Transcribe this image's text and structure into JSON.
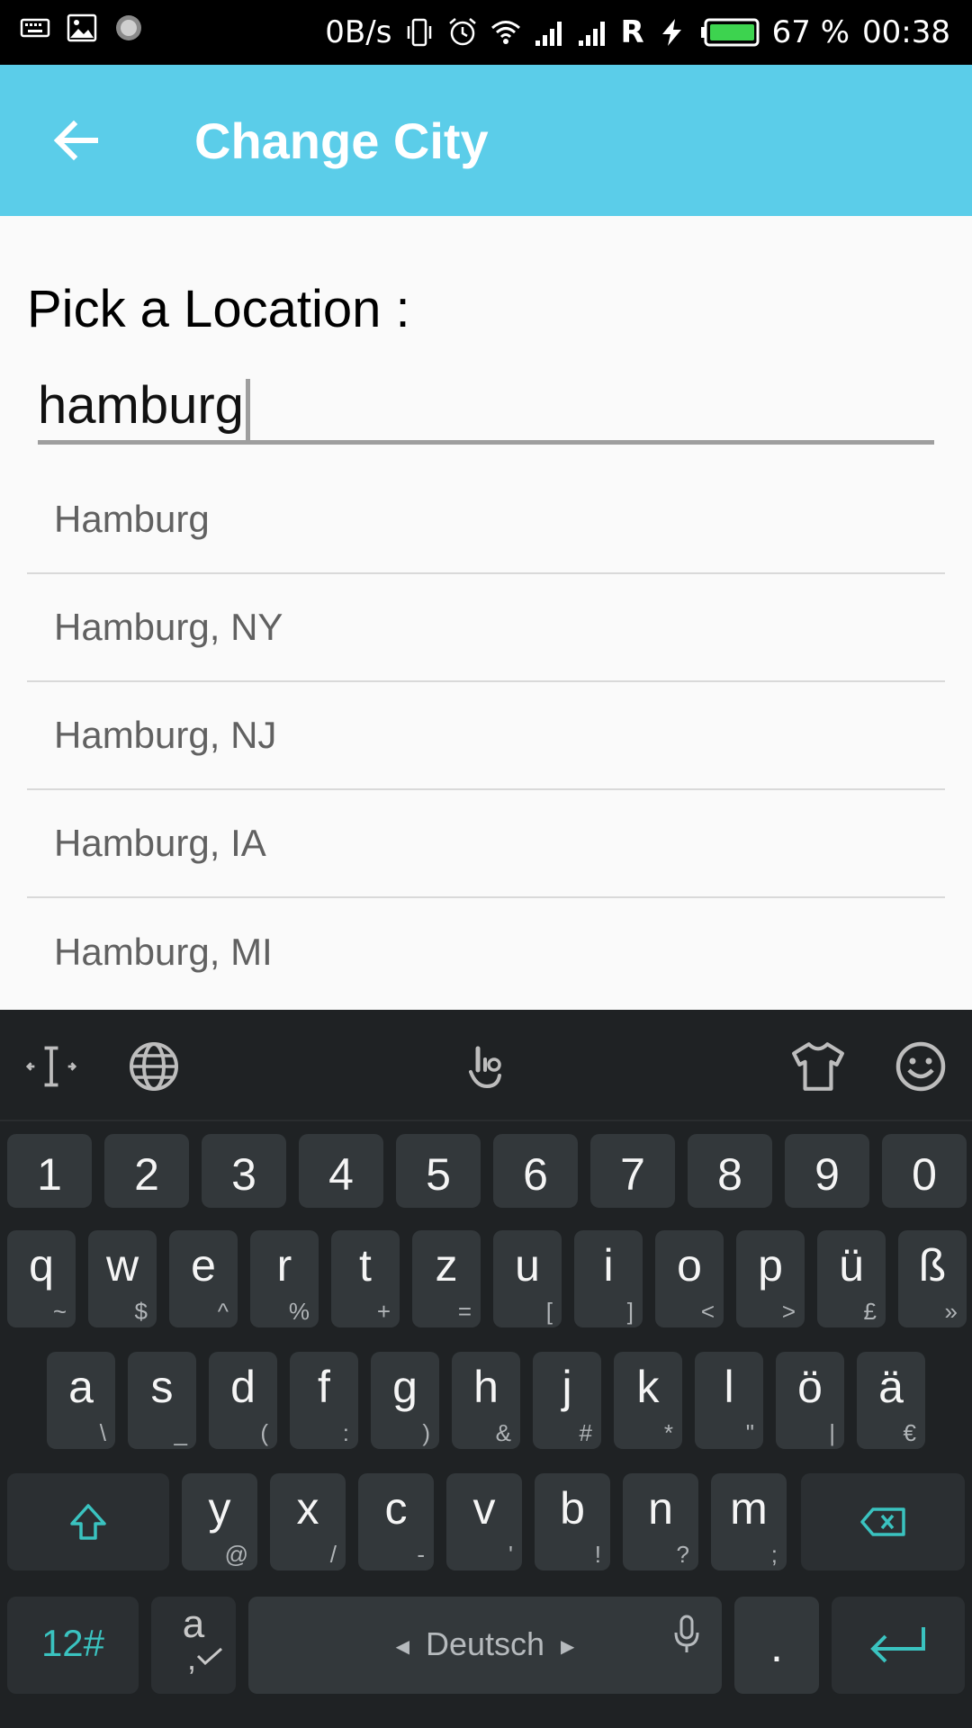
{
  "status_bar": {
    "net_speed": "0B/s",
    "carrier_flag": "R",
    "battery": "67 %",
    "time": "00:38",
    "battery_color": "#3dd34f"
  },
  "app_bar": {
    "title": "Change City",
    "back_icon": "arrow-left-icon",
    "background": "#5bcde9"
  },
  "form": {
    "label": "Pick a Location :",
    "input_value": "hamburg"
  },
  "suggestions": [
    "Hamburg",
    "Hamburg, NY",
    "Hamburg, NJ",
    "Hamburg, IA",
    "Hamburg, MI"
  ],
  "keyboard": {
    "toolbar_icons": [
      "cursor-icon",
      "globe-icon",
      "gesture-icon",
      "theme-shirt-icon",
      "emoji-icon"
    ],
    "number_row": [
      "1",
      "2",
      "3",
      "4",
      "5",
      "6",
      "7",
      "8",
      "9",
      "0"
    ],
    "row1": [
      {
        "key": "q",
        "sub": "~"
      },
      {
        "key": "w",
        "sub": "$"
      },
      {
        "key": "e",
        "sub": "^"
      },
      {
        "key": "r",
        "sub": "%"
      },
      {
        "key": "t",
        "sub": "+"
      },
      {
        "key": "z",
        "sub": "="
      },
      {
        "key": "u",
        "sub": "["
      },
      {
        "key": "i",
        "sub": "]"
      },
      {
        "key": "o",
        "sub": "<"
      },
      {
        "key": "p",
        "sub": ">"
      },
      {
        "key": "ü",
        "sub": "£"
      },
      {
        "key": "ß",
        "sub": "»"
      }
    ],
    "row2": [
      {
        "key": "a",
        "sub": "\\"
      },
      {
        "key": "s",
        "sub": "_"
      },
      {
        "key": "d",
        "sub": "("
      },
      {
        "key": "f",
        "sub": ":"
      },
      {
        "key": "g",
        "sub": ")"
      },
      {
        "key": "h",
        "sub": "&"
      },
      {
        "key": "j",
        "sub": "#"
      },
      {
        "key": "k",
        "sub": "*"
      },
      {
        "key": "l",
        "sub": "\""
      },
      {
        "key": "ö",
        "sub": "|"
      },
      {
        "key": "ä",
        "sub": "€"
      }
    ],
    "row3": [
      {
        "key": "y",
        "sub": "@"
      },
      {
        "key": "x",
        "sub": "/"
      },
      {
        "key": "c",
        "sub": "-"
      },
      {
        "key": "v",
        "sub": "'"
      },
      {
        "key": "b",
        "sub": "!"
      },
      {
        "key": "n",
        "sub": "?"
      },
      {
        "key": "m",
        "sub": ";"
      }
    ],
    "symbols_label": "12#",
    "lang_switch_label": "a",
    "lang_switch_sub": ",",
    "space_label": "Deutsch",
    "period_label": ".",
    "accent_color": "#3ac3c0"
  }
}
